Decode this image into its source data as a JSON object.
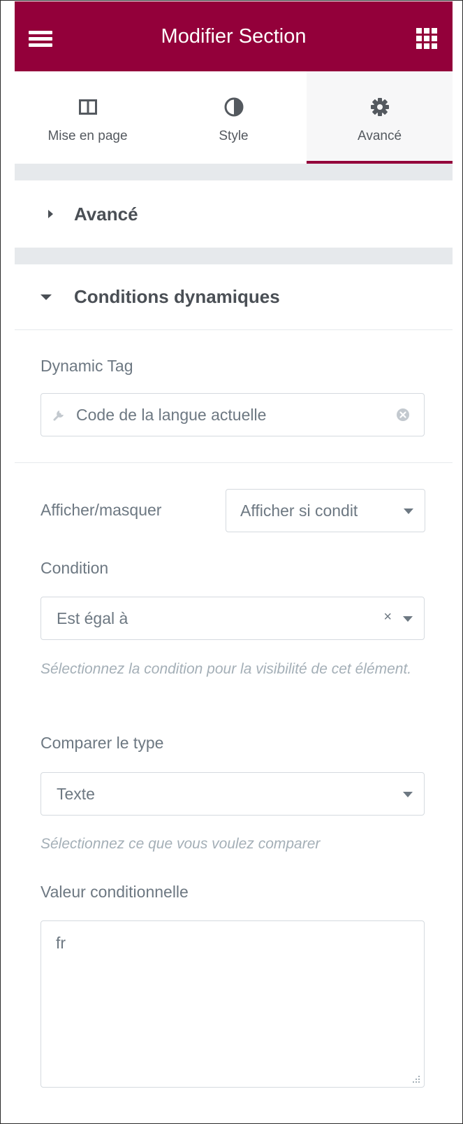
{
  "header": {
    "title": "Modifier Section",
    "background": "#93003a",
    "menu_icon": "hamburger-icon",
    "apps_icon": "grid-icon"
  },
  "tabs": [
    {
      "label": "Mise en page",
      "icon": "columns-icon",
      "active": false
    },
    {
      "label": "Style",
      "icon": "half-circle-icon",
      "active": false
    },
    {
      "label": "Avancé",
      "icon": "gear-icon",
      "active": true
    }
  ],
  "sections": {
    "advanced": {
      "title": "Avancé",
      "expanded": false
    },
    "conditions": {
      "title": "Conditions dynamiques",
      "expanded": true
    }
  },
  "form": {
    "dynamic_tag": {
      "label": "Dynamic Tag",
      "value": "Code de la langue actuelle"
    },
    "show_hide": {
      "label": "Afficher/masquer",
      "value": "Afficher si condit"
    },
    "condition": {
      "label": "Condition",
      "value": "Est égal à",
      "help": "Sélectionnez la condition pour la visibilité de cet élément."
    },
    "compare_type": {
      "label": "Comparer le type",
      "value": "Texte",
      "help": "Sélectionnez ce que vous voulez comparer"
    },
    "conditional_value": {
      "label": "Valeur conditionnelle",
      "value": "fr"
    }
  },
  "colors": {
    "accent": "#93003a",
    "text": "#6d7882",
    "heading": "#4a4f55",
    "muted": "#a4afb7",
    "separator": "#e6e9ec"
  }
}
